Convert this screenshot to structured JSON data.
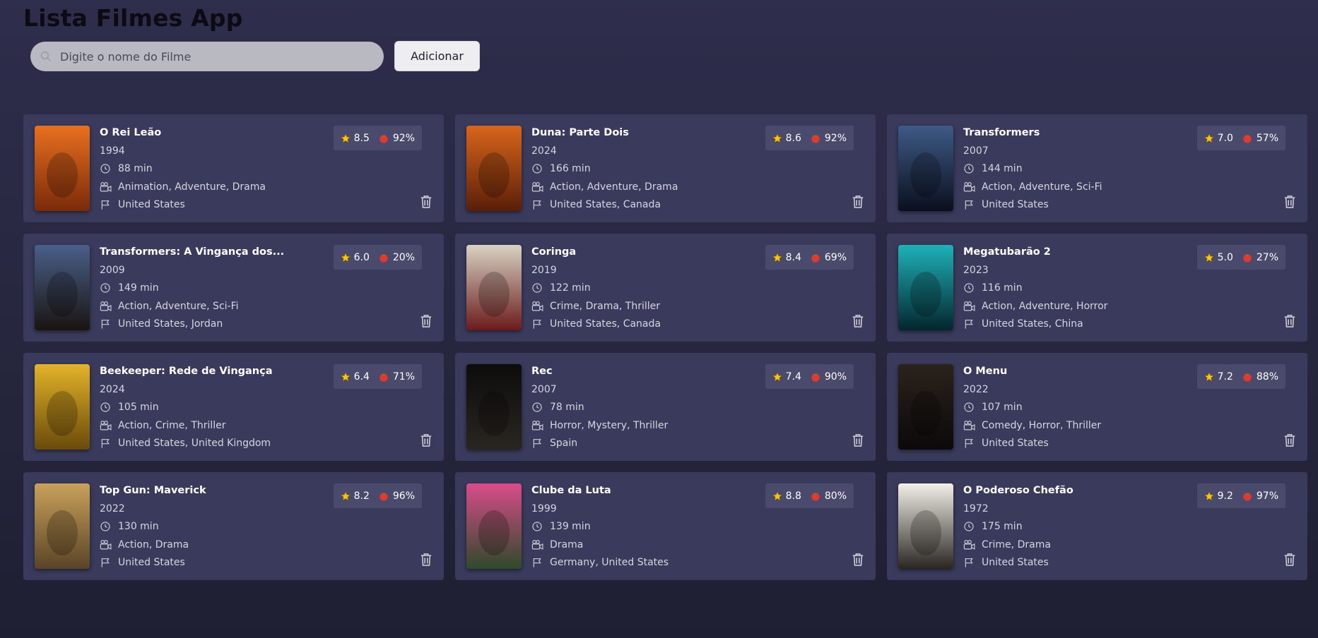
{
  "app": {
    "title": "Lista Filmes App"
  },
  "search": {
    "placeholder": "Digite o nome do Filme",
    "value": "",
    "icon": "search-icon"
  },
  "add_button": {
    "label": "Adicionar"
  },
  "colors": {
    "card_bg": "#3a3a5c",
    "badge_bg": "#4a4a6c",
    "star": "#f5c518",
    "tomato": "#e03a2e"
  },
  "movies": [
    {
      "title": "O Rei Leão",
      "year": "1994",
      "duration": "88 min",
      "genres": "Animation, Adventure, Drama",
      "countries": "United States",
      "imdb": "8.5",
      "rotten": "92%",
      "poster_colors": [
        "#e8701f",
        "#7a2a0a"
      ]
    },
    {
      "title": "Duna: Parte Dois",
      "year": "2024",
      "duration": "166 min",
      "genres": "Action, Adventure, Drama",
      "countries": "United States, Canada",
      "imdb": "8.6",
      "rotten": "92%",
      "poster_colors": [
        "#d9651c",
        "#5a1f08"
      ]
    },
    {
      "title": "Transformers",
      "year": "2007",
      "duration": "144 min",
      "genres": "Action, Adventure, Sci-Fi",
      "countries": "United States",
      "imdb": "7.0",
      "rotten": "57%",
      "poster_colors": [
        "#3e5a85",
        "#0a0f1e"
      ]
    },
    {
      "title": "Transformers: A Vingança dos...",
      "year": "2009",
      "duration": "149 min",
      "genres": "Action, Adventure, Sci-Fi",
      "countries": "United States, Jordan",
      "imdb": "6.0",
      "rotten": "20%",
      "poster_colors": [
        "#4a5f8a",
        "#1a1410"
      ]
    },
    {
      "title": "Coringa",
      "year": "2019",
      "duration": "122 min",
      "genres": "Crime, Drama, Thriller",
      "countries": "United States, Canada",
      "imdb": "8.4",
      "rotten": "69%",
      "poster_colors": [
        "#d8d2c4",
        "#6b1b1b"
      ]
    },
    {
      "title": "Megatubarão 2",
      "year": "2023",
      "duration": "116 min",
      "genres": "Action, Adventure, Horror",
      "countries": "United States, China",
      "imdb": "5.0",
      "rotten": "27%",
      "poster_colors": [
        "#1fb1b8",
        "#04262e"
      ]
    },
    {
      "title": "Beekeeper: Rede de Vingança",
      "year": "2024",
      "duration": "105 min",
      "genres": "Action, Crime, Thriller",
      "countries": "United States, United Kingdom",
      "imdb": "6.4",
      "rotten": "71%",
      "poster_colors": [
        "#e3b32a",
        "#6a4a0a"
      ]
    },
    {
      "title": "Rec",
      "year": "2007",
      "duration": "78 min",
      "genres": "Horror, Mystery, Thriller",
      "countries": "Spain",
      "imdb": "7.4",
      "rotten": "90%",
      "poster_colors": [
        "#0c0c0c",
        "#2a2520"
      ]
    },
    {
      "title": "O Menu",
      "year": "2022",
      "duration": "107 min",
      "genres": "Comedy, Horror, Thriller",
      "countries": "United States",
      "imdb": "7.2",
      "rotten": "88%",
      "poster_colors": [
        "#2a221c",
        "#0c0908"
      ]
    },
    {
      "title": "Top Gun: Maverick",
      "year": "2022",
      "duration": "130 min",
      "genres": "Action, Drama",
      "countries": "United States",
      "imdb": "8.2",
      "rotten": "96%",
      "poster_colors": [
        "#c9a15a",
        "#5a4426"
      ]
    },
    {
      "title": "Clube da Luta",
      "year": "1999",
      "duration": "139 min",
      "genres": "Drama",
      "countries": "Germany, United States",
      "imdb": "8.8",
      "rotten": "80%",
      "poster_colors": [
        "#d94c8a",
        "#2f4a2a"
      ]
    },
    {
      "title": "O Poderoso Chefão",
      "year": "1972",
      "duration": "175 min",
      "genres": "Crime, Drama",
      "countries": "United States",
      "imdb": "9.2",
      "rotten": "97%",
      "poster_colors": [
        "#f3f0ea",
        "#2a2520"
      ]
    }
  ],
  "icons": {
    "duration": "clock-icon",
    "genres": "camera-icon",
    "countries": "flag-icon",
    "imdb": "star-icon",
    "rotten": "tomato-icon",
    "delete": "trash-icon"
  }
}
